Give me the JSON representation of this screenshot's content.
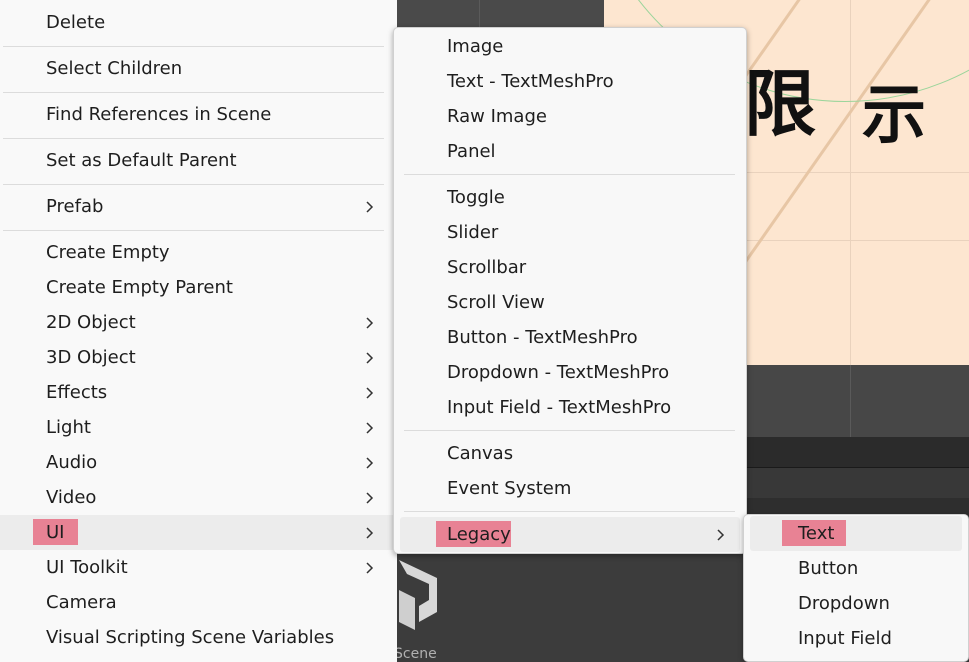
{
  "context_menu": {
    "items": [
      {
        "label": "Delete"
      },
      {
        "label": "Select Children"
      },
      {
        "label": "Find References in Scene"
      },
      {
        "label": "Set as Default Parent"
      },
      {
        "label": "Prefab",
        "submenu": true
      },
      {
        "label": "Create Empty"
      },
      {
        "label": "Create Empty Parent"
      },
      {
        "label": "2D Object",
        "submenu": true
      },
      {
        "label": "3D Object",
        "submenu": true
      },
      {
        "label": "Effects",
        "submenu": true
      },
      {
        "label": "Light",
        "submenu": true
      },
      {
        "label": "Audio",
        "submenu": true
      },
      {
        "label": "Video",
        "submenu": true
      },
      {
        "label": "UI",
        "submenu": true,
        "active": true,
        "highlighted": true
      },
      {
        "label": "UI Toolkit",
        "submenu": true
      },
      {
        "label": "Camera"
      },
      {
        "label": "Visual Scripting Scene Variables"
      }
    ]
  },
  "ui_submenu": {
    "items": [
      {
        "label": "Image"
      },
      {
        "label": "Text - TextMeshPro"
      },
      {
        "label": "Raw Image"
      },
      {
        "label": "Panel"
      },
      {
        "label": "Toggle"
      },
      {
        "label": "Slider"
      },
      {
        "label": "Scrollbar"
      },
      {
        "label": "Scroll View"
      },
      {
        "label": "Button - TextMeshPro"
      },
      {
        "label": "Dropdown - TextMeshPro"
      },
      {
        "label": "Input Field - TextMeshPro"
      },
      {
        "label": "Canvas"
      },
      {
        "label": "Event System"
      },
      {
        "label": "Legacy",
        "submenu": true,
        "active": true,
        "highlighted": true
      }
    ]
  },
  "legacy_submenu": {
    "items": [
      {
        "label": "Text",
        "active": true,
        "highlighted": true
      },
      {
        "label": "Button"
      },
      {
        "label": "Dropdown"
      },
      {
        "label": "Input Field"
      }
    ]
  },
  "scene": {
    "caption": "Scene",
    "glyph_1": "限",
    "glyph_2": "示"
  },
  "colors": {
    "menu_bg": "#f9f9f9",
    "hover_bg": "#ececec",
    "annotation_highlight": "#e63c5a",
    "scene_bg": "#fde6d0",
    "editor_dark": "#3c3c3c"
  },
  "icons": {
    "submenu_arrow": "chevron-right-icon",
    "unity_logo": "unity-logo-icon"
  }
}
